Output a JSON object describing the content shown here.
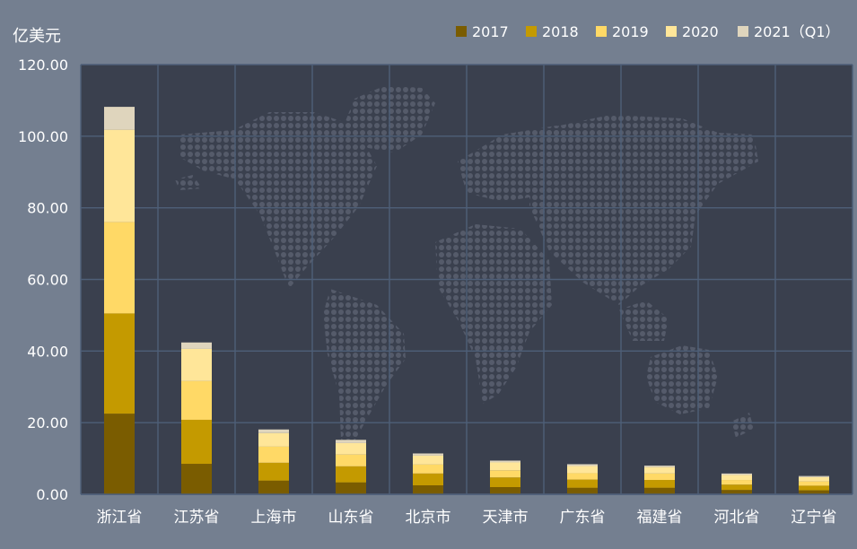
{
  "chart_data": {
    "type": "bar",
    "stacked": true,
    "unit": "亿美元",
    "categories": [
      "浙江省",
      "江苏省",
      "上海市",
      "山东省",
      "北京市",
      "天津市",
      "广东省",
      "福建省",
      "河北省",
      "辽宁省"
    ],
    "series": [
      {
        "name": "2017",
        "color": "#7a5c00",
        "values": [
          22.5,
          8.5,
          3.8,
          3.3,
          2.5,
          2.0,
          1.8,
          1.8,
          1.2,
          1.1
        ]
      },
      {
        "name": "2018",
        "color": "#c49a00",
        "values": [
          28.0,
          12.3,
          5.0,
          4.5,
          3.3,
          2.7,
          2.3,
          2.2,
          1.5,
          1.3
        ]
      },
      {
        "name": "2019",
        "color": "#ffd966",
        "values": [
          25.5,
          10.8,
          4.5,
          3.3,
          2.5,
          2.0,
          1.8,
          1.8,
          1.3,
          1.2
        ]
      },
      {
        "name": "2020",
        "color": "#ffe699",
        "values": [
          25.8,
          9.0,
          3.8,
          3.2,
          2.5,
          2.2,
          2.0,
          1.8,
          1.4,
          1.2
        ]
      },
      {
        "name": "2021（Q1）",
        "color": "#dfd5bd",
        "values": [
          6.4,
          1.8,
          1.0,
          0.9,
          0.6,
          0.5,
          0.5,
          0.4,
          0.4,
          0.3
        ]
      }
    ],
    "ylim": [
      0,
      120
    ],
    "yticks": [
      "0.00",
      "20.00",
      "40.00",
      "60.00",
      "80.00",
      "100.00",
      "120.00"
    ],
    "grid": true,
    "legend_position": "top-right",
    "background": "world-map-dots"
  }
}
